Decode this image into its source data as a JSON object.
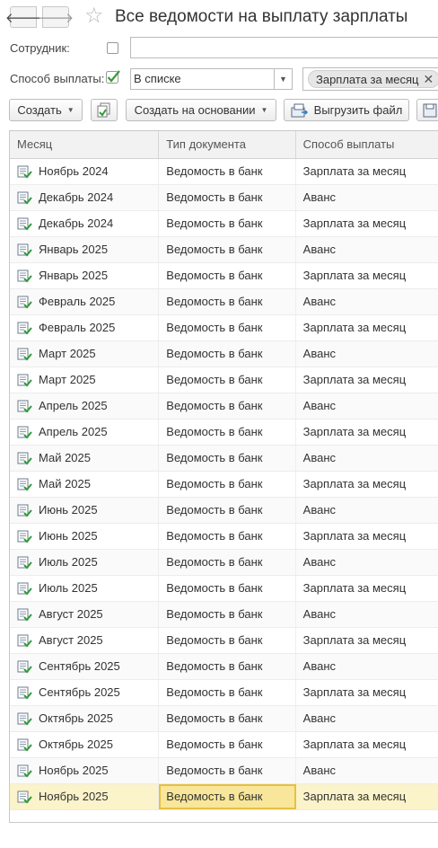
{
  "window": {
    "title": "Все ведомости на выплату зарплаты"
  },
  "nav": {
    "back": "🡐",
    "forward": "🡒",
    "favorite": "☆"
  },
  "filters": {
    "employee_label": "Сотрудник:",
    "employee_value": "",
    "method_label": "Способ выплаты:",
    "method_checked": true,
    "method_condition": "В списке",
    "method_tag": "Зарплата за месяц"
  },
  "toolbar": {
    "create": "Создать",
    "create_based": "Создать на основании",
    "export_file": "Выгрузить файл"
  },
  "table": {
    "columns": [
      "Месяц",
      "Тип документа",
      "Способ выплаты"
    ],
    "rows": [
      [
        "Ноябрь 2024",
        "Ведомость в банк",
        "Зарплата за месяц"
      ],
      [
        "Декабрь 2024",
        "Ведомость в банк",
        "Аванс"
      ],
      [
        "Декабрь 2024",
        "Ведомость в банк",
        "Зарплата за месяц"
      ],
      [
        "Январь 2025",
        "Ведомость в банк",
        "Аванс"
      ],
      [
        "Январь 2025",
        "Ведомость в банк",
        "Зарплата за месяц"
      ],
      [
        "Февраль 2025",
        "Ведомость в банк",
        "Аванс"
      ],
      [
        "Февраль 2025",
        "Ведомость в банк",
        "Зарплата за месяц"
      ],
      [
        "Март 2025",
        "Ведомость в банк",
        "Аванс"
      ],
      [
        "Март 2025",
        "Ведомость в банк",
        "Зарплата за месяц"
      ],
      [
        "Апрель 2025",
        "Ведомость в банк",
        "Аванс"
      ],
      [
        "Апрель 2025",
        "Ведомость в банк",
        "Зарплата за месяц"
      ],
      [
        "Май 2025",
        "Ведомость в банк",
        "Аванс"
      ],
      [
        "Май 2025",
        "Ведомость в банк",
        "Зарплата за месяц"
      ],
      [
        "Июнь 2025",
        "Ведомость в банк",
        "Аванс"
      ],
      [
        "Июнь 2025",
        "Ведомость в банк",
        "Зарплата за месяц"
      ],
      [
        "Июль 2025",
        "Ведомость в банк",
        "Аванс"
      ],
      [
        "Июль 2025",
        "Ведомость в банк",
        "Зарплата за месяц"
      ],
      [
        "Август 2025",
        "Ведомость в банк",
        "Аванс"
      ],
      [
        "Август 2025",
        "Ведомость в банк",
        "Зарплата за месяц"
      ],
      [
        "Сентябрь 2025",
        "Ведомость в банк",
        "Аванс"
      ],
      [
        "Сентябрь 2025",
        "Ведомость в банк",
        "Зарплата за месяц"
      ],
      [
        "Октябрь 2025",
        "Ведомость в банк",
        "Аванс"
      ],
      [
        "Октябрь 2025",
        "Ведомость в банк",
        "Зарплата за месяц"
      ],
      [
        "Ноябрь 2025",
        "Ведомость в банк",
        "Аванс"
      ],
      [
        "Ноябрь 2025",
        "Ведомость в банк",
        "Зарплата за месяц"
      ]
    ],
    "selected_row": 24
  },
  "colors": {
    "check": "#3a9a3a",
    "selected_row": "#fbf3c9",
    "selected_cell_border": "#e6c040"
  }
}
